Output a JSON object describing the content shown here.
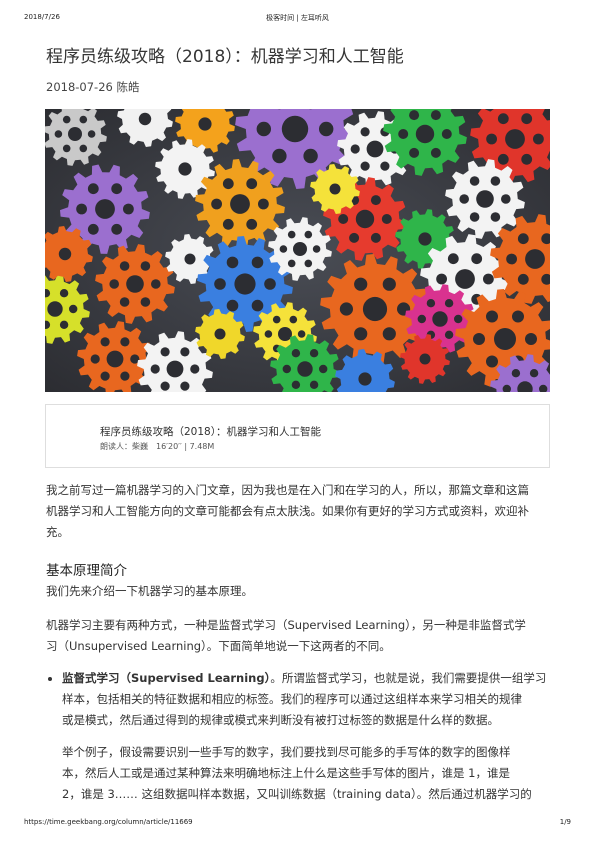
{
  "header": {
    "date": "2018/7/26",
    "site": "极客时间 | 左耳听风"
  },
  "article": {
    "title": "程序员练级攻略（2018）：机器学习和人工智能",
    "meta": "2018-07-26 陈皓",
    "hero_icon": "colorful-gears-image",
    "audio": {
      "title": "程序员练级攻略（2018）：机器学习和人工智能",
      "info": "朗读人：柴巍　16′20′′ | 7.48M"
    },
    "intro": [
      "我之前写过一篇机器学习的入门文章，因为我也是在入门和在学习的人，所以，那篇文章和这篇",
      "机器学习和人工智能方向的文章可能都会有点太肤浅。如果你有更好的学习方式或资料，欢迎补",
      "充。"
    ],
    "section_title": "基本原理简介",
    "p1": "我们先来介绍一下机器学习的基本原理。",
    "p2": [
      "机器学习主要有两种方式，一种是监督式学习（Supervised Learning），另一种是非监督式学",
      "习（Unsupervised Learning）。下面简单地说一下这两者的不同。"
    ],
    "li_bold": "监督式学习（Supervised Learning）",
    "li_text": [
      "。所谓监督式学习，也就是说，我们需要提供一组学习",
      "样本，包括相关的特征数据和相应的标签。我们的程序可以通过这组样本来学习相关的规律",
      "或是模式，然后通过得到的规律或模式来判断没有被打过标签的数据是什么样的数据。"
    ],
    "example": [
      "举个例子，假设需要识别一些手写的数字，我们要找到尽可能多的手写体的数字的图像样",
      "本，然后人工或是通过某种算法来明确地标注上什么是这些手写体的图片，谁是 1，谁是",
      "2，谁是 3…… 这组数据叫样本数据，又叫训练数据（training data）。然后通过机器学习的"
    ]
  },
  "footer": {
    "url": "https://time.geekbang.org/column/article/11669",
    "page": "1/9"
  }
}
